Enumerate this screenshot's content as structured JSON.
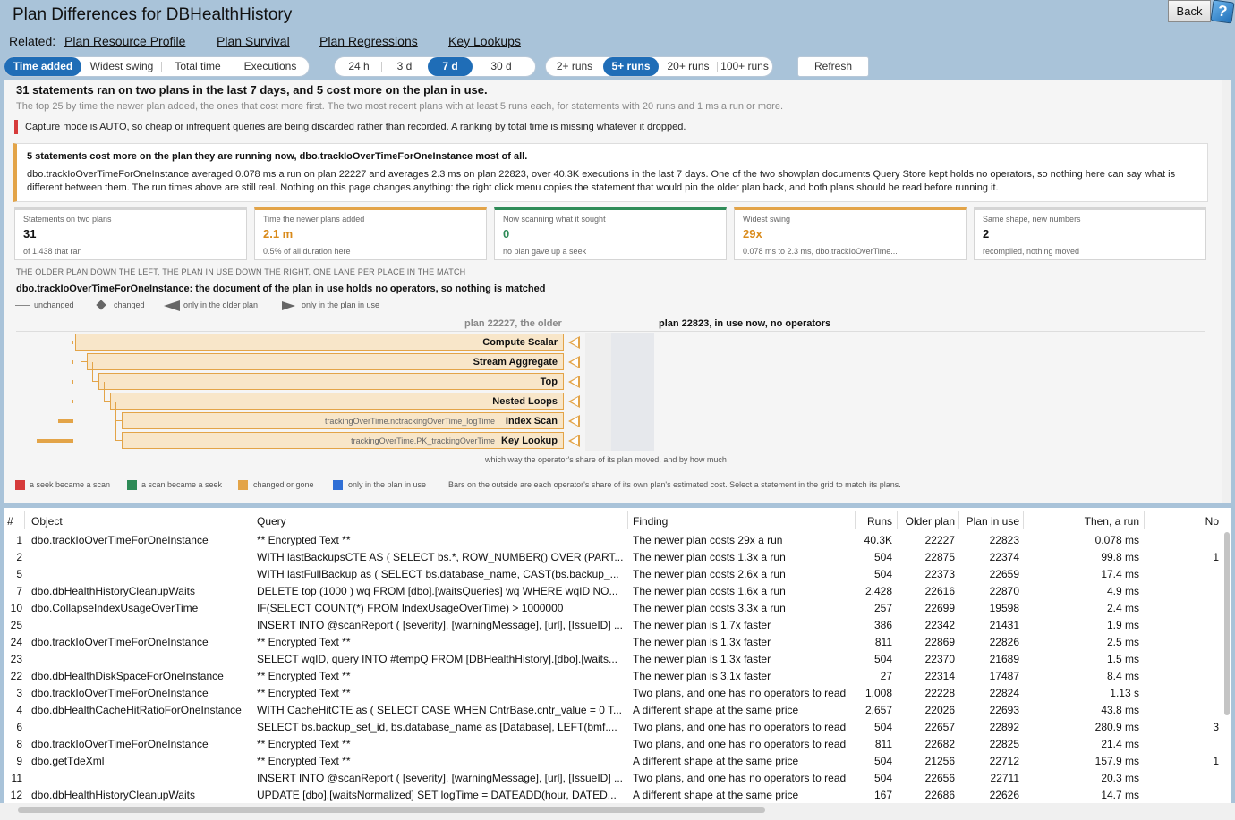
{
  "header": {
    "title": "Plan Differences for DBHealthHistory",
    "back_label": "Back",
    "help_icon": "?",
    "related_label": "Related:",
    "related_links": [
      "Plan Resource Profile",
      "Plan Survival",
      "Plan Regressions",
      "Key Lookups"
    ]
  },
  "toolbar": {
    "sort_options": [
      "Time added",
      "Widest swing",
      "Total time",
      "Executions"
    ],
    "window_options": [
      "24 h",
      "3 d",
      "7 d",
      "30 d"
    ],
    "runs_options": [
      "2+ runs",
      "5+ runs",
      "20+ runs",
      "100+ runs"
    ],
    "refresh_label": "Refresh",
    "accent": "#1f6db7"
  },
  "summary": {
    "headline": "31 statements ran on two plans in the last 7 days, and 5 cost more on the plan in use.",
    "subline": "The top 25 by time the newer plan added, the ones that cost more first. The two most recent plans with at least 5 runs each, for statements with 20 runs and 1 ms a run or more.",
    "capture_note": "Capture mode is AUTO, so cheap or infrequent queries are being discarded rather than recorded. A ranking by total time is missing whatever it dropped.",
    "callout_title": "5 statements cost more on the plan they are running now, dbo.trackIoOverTimeForOneInstance most of all.",
    "callout_body_1": "dbo.trackIoOverTimeForOneInstance averaged 0.078 ms a run on plan 22227 and averages 2.3 ms on plan 22823, over 40.3K executions in the last 7 days. One of the two showplan documents Query Store kept holds no operators, so nothing here can say what is",
    "callout_body_2": "different between them. The run times above are still real. Nothing on this page changes anything: the right click menu copies the statement that would pin the older plan back, and both plans should be read before running it."
  },
  "cards": [
    {
      "label": "Statements on two plans",
      "value": "31",
      "sub": "of 1,438 that ran",
      "accent": "#d5d5d5",
      "value_color": "#111111"
    },
    {
      "label": "Time the newer plans added",
      "value": "2.1 m",
      "sub": "0.5% of all duration here",
      "accent": "#e3a448",
      "value_color": "#d98a1a"
    },
    {
      "label": "Now scanning what it sought",
      "value": "0",
      "sub": "no plan gave up a seek",
      "accent": "#2e8b57",
      "value_color": "#2e8b57"
    },
    {
      "label": "Widest swing",
      "value": "29x",
      "sub": "0.078 ms to 2.3 ms, dbo.trackIoOverTime...",
      "accent": "#e3a448",
      "value_color": "#d98a1a"
    },
    {
      "label": "Same shape, new numbers",
      "value": "2",
      "sub": "recompiled, nothing moved",
      "accent": "#d5d5d5",
      "value_color": "#111111"
    }
  ],
  "plan_compare": {
    "section_caption": "THE OLDER PLAN DOWN THE LEFT, THE PLAN IN USE DOWN THE RIGHT, ONE LANE PER PLACE IN THE MATCH",
    "statement_title": "dbo.trackIoOverTimeForOneInstance: the document of the plan in use holds no operators, so nothing is matched",
    "legend": [
      "unchanged",
      "changed",
      "only in the older plan",
      "only in the plan in use"
    ],
    "left_header": "plan 22227, the older",
    "right_header": "plan 22823, in use now, no operators",
    "operators": [
      {
        "name": "Compute Scalar",
        "index": "",
        "depth": 0,
        "cost": 0.02
      },
      {
        "name": "Stream Aggregate",
        "index": "",
        "depth": 1,
        "cost": 0.02
      },
      {
        "name": "Top",
        "index": "",
        "depth": 2,
        "cost": 0.02
      },
      {
        "name": "Nested Loops",
        "index": "",
        "depth": 3,
        "cost": 0.02
      },
      {
        "name": "Index Scan",
        "index": "trackingOverTime.nctrackingOverTime_logTime",
        "depth": 4,
        "cost": 0.35
      },
      {
        "name": "Key Lookup",
        "index": "trackingOverTime.PK_trackingOverTime",
        "depth": 4,
        "cost": 0.85
      }
    ],
    "axis_note": "which way the operator's share of its plan moved, and by how much",
    "color_legend": [
      {
        "label": "a seek became a scan",
        "color": "#d63b3b"
      },
      {
        "label": "a scan became a seek",
        "color": "#2e8b57"
      },
      {
        "label": "changed or gone",
        "color": "#e3a448"
      },
      {
        "label": "only in the plan in use",
        "color": "#2f6fd6"
      }
    ],
    "bars_note": "Bars on the outside are each operator's share of its own plan's estimated cost. Select a statement in the grid to match its plans."
  },
  "grid": {
    "columns": [
      "#",
      "Object",
      "Query",
      "Finding",
      "Runs",
      "Older plan",
      "Plan in use",
      "Then, a run",
      "No"
    ],
    "rows": [
      {
        "n": "1",
        "obj": "dbo.trackIoOverTimeForOneInstance",
        "q": "** Encrypted Text **",
        "f": "The newer plan costs 29x a run",
        "runs": "40.3K",
        "old": "22227",
        "cur": "22823",
        "then": "0.078 ms",
        "now": ""
      },
      {
        "n": "2",
        "obj": "",
        "q": "WITH lastBackupsCTE AS ( SELECT bs.*, ROW_NUMBER() OVER (PART...",
        "f": "The newer plan costs 1.3x a run",
        "runs": "504",
        "old": "22875",
        "cur": "22374",
        "then": "99.8 ms",
        "now": "1"
      },
      {
        "n": "5",
        "obj": "",
        "q": "WITH lastFullBackup as ( SELECT bs.database_name, CAST(bs.backup_...",
        "f": "The newer plan costs 2.6x a run",
        "runs": "504",
        "old": "22373",
        "cur": "22659",
        "then": "17.4 ms",
        "now": ""
      },
      {
        "n": "7",
        "obj": "dbo.dbHealthHistoryCleanupWaits",
        "q": "DELETE top (1000 ) wq FROM [dbo].[waitsQueries] wq WHERE wqID NO...",
        "f": "The newer plan costs 1.6x a run",
        "runs": "2,428",
        "old": "22616",
        "cur": "22870",
        "then": "4.9 ms",
        "now": ""
      },
      {
        "n": "10",
        "obj": "dbo.CollapseIndexUsageOverTime",
        "q": "IF(SELECT COUNT(*) FROM IndexUsageOverTime) > 1000000",
        "f": "The newer plan costs 3.3x a run",
        "runs": "257",
        "old": "22699",
        "cur": "19598",
        "then": "2.4 ms",
        "now": ""
      },
      {
        "n": "25",
        "obj": "",
        "q": "INSERT INTO @scanReport ( [severity], [warningMessage], [url], [IssueID] ...",
        "f": "The newer plan is 1.7x faster",
        "runs": "386",
        "old": "22342",
        "cur": "21431",
        "then": "1.9 ms",
        "now": ""
      },
      {
        "n": "24",
        "obj": "dbo.trackIoOverTimeForOneInstance",
        "q": "** Encrypted Text **",
        "f": "The newer plan is 1.3x faster",
        "runs": "811",
        "old": "22869",
        "cur": "22826",
        "then": "2.5 ms",
        "now": ""
      },
      {
        "n": "23",
        "obj": "",
        "q": "SELECT wqID, query INTO #tempQ FROM [DBHealthHistory].[dbo].[waits...",
        "f": "The newer plan is 1.3x faster",
        "runs": "504",
        "old": "22370",
        "cur": "21689",
        "then": "1.5 ms",
        "now": ""
      },
      {
        "n": "22",
        "obj": "dbo.dbHealthDiskSpaceForOneInstance",
        "q": "** Encrypted Text **",
        "f": "The newer plan is 3.1x faster",
        "runs": "27",
        "old": "22314",
        "cur": "17487",
        "then": "8.4 ms",
        "now": ""
      },
      {
        "n": "3",
        "obj": "dbo.trackIoOverTimeForOneInstance",
        "q": "** Encrypted Text **",
        "f": "Two plans, and one has no operators to read",
        "runs": "1,008",
        "old": "22228",
        "cur": "22824",
        "then": "1.13 s",
        "now": ""
      },
      {
        "n": "4",
        "obj": "dbo.dbHealthCacheHitRatioForOneInstance",
        "q": "WITH CacheHitCTE as ( SELECT CASE WHEN CntrBase.cntr_value = 0 T...",
        "f": "A different shape at the same price",
        "runs": "2,657",
        "old": "22026",
        "cur": "22693",
        "then": "43.8 ms",
        "now": ""
      },
      {
        "n": "6",
        "obj": "",
        "q": "SELECT bs.backup_set_id, bs.database_name as [Database], LEFT(bmf....",
        "f": "Two plans, and one has no operators to read",
        "runs": "504",
        "old": "22657",
        "cur": "22892",
        "then": "280.9 ms",
        "now": "3"
      },
      {
        "n": "8",
        "obj": "dbo.trackIoOverTimeForOneInstance",
        "q": "** Encrypted Text **",
        "f": "Two plans, and one has no operators to read",
        "runs": "811",
        "old": "22682",
        "cur": "22825",
        "then": "21.4 ms",
        "now": ""
      },
      {
        "n": "9",
        "obj": "dbo.getTdeXml",
        "q": "** Encrypted Text **",
        "f": "A different shape at the same price",
        "runs": "504",
        "old": "21256",
        "cur": "22712",
        "then": "157.9 ms",
        "now": "1"
      },
      {
        "n": "11",
        "obj": "",
        "q": "INSERT INTO @scanReport ( [severity], [warningMessage], [url], [IssueID] ...",
        "f": "Two plans, and one has no operators to read",
        "runs": "504",
        "old": "22656",
        "cur": "22711",
        "then": "20.3 ms",
        "now": ""
      },
      {
        "n": "12",
        "obj": "dbo.dbHealthHistoryCleanupWaits",
        "q": "UPDATE [dbo].[waitsNormalized] SET logTime = DATEADD(hour, DATED...",
        "f": "A different shape at the same price",
        "runs": "167",
        "old": "22686",
        "cur": "22626",
        "then": "14.7 ms",
        "now": ""
      }
    ]
  }
}
